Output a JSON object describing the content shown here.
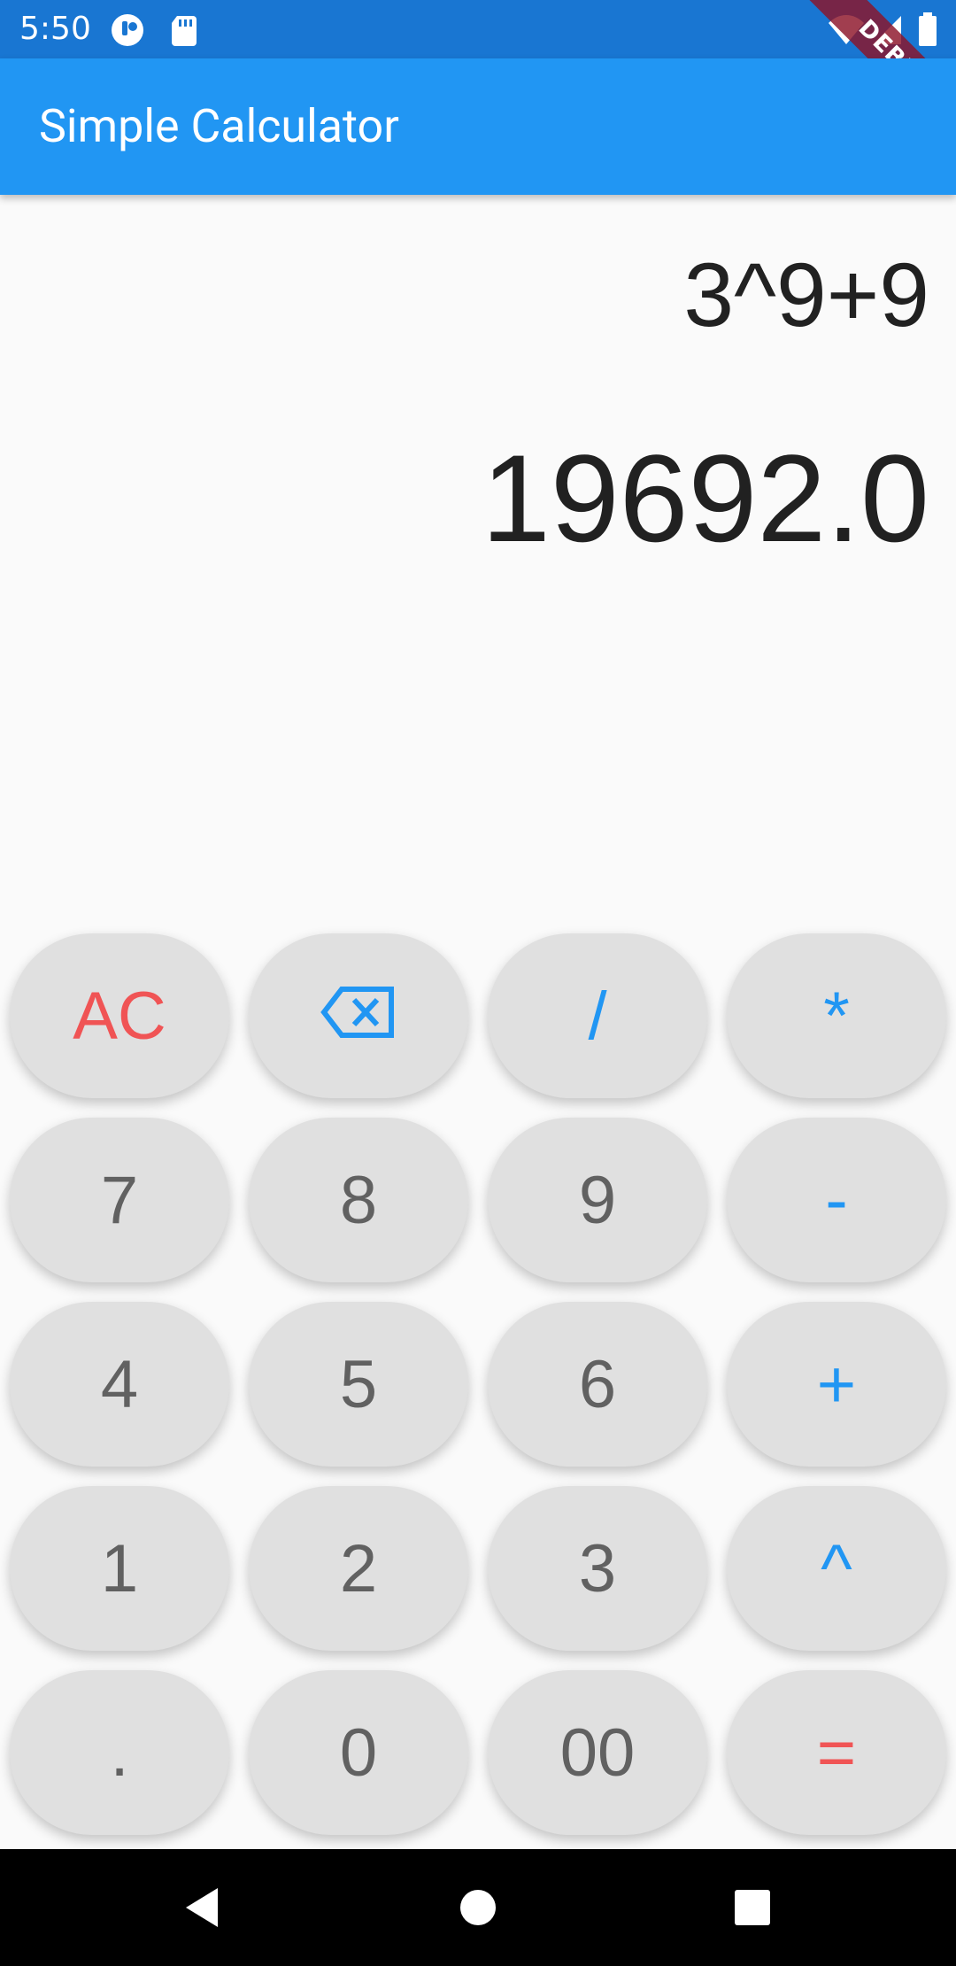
{
  "status_bar": {
    "time": "5:50",
    "left_icons": [
      "circle-app-icon",
      "sd-card-icon"
    ],
    "right_icons": [
      "wifi-icon",
      "signal-icon",
      "battery-icon"
    ],
    "debug_banner": "DEBUG"
  },
  "app_bar": {
    "title": "Simple Calculator"
  },
  "display": {
    "expression": "3^9+9",
    "result": "19692.0"
  },
  "keypad": {
    "rows": [
      [
        {
          "label": "AC",
          "kind": "danger"
        },
        {
          "label": "",
          "kind": "op",
          "icon": "backspace-icon"
        },
        {
          "label": "/",
          "kind": "op"
        },
        {
          "label": "*",
          "kind": "op"
        }
      ],
      [
        {
          "label": "7",
          "kind": "num"
        },
        {
          "label": "8",
          "kind": "num"
        },
        {
          "label": "9",
          "kind": "num"
        },
        {
          "label": "-",
          "kind": "op"
        }
      ],
      [
        {
          "label": "4",
          "kind": "num"
        },
        {
          "label": "5",
          "kind": "num"
        },
        {
          "label": "6",
          "kind": "num"
        },
        {
          "label": "+",
          "kind": "op"
        }
      ],
      [
        {
          "label": "1",
          "kind": "num"
        },
        {
          "label": "2",
          "kind": "num"
        },
        {
          "label": "3",
          "kind": "num"
        },
        {
          "label": "^",
          "kind": "op"
        }
      ],
      [
        {
          "label": ".",
          "kind": "num"
        },
        {
          "label": "0",
          "kind": "num"
        },
        {
          "label": "00",
          "kind": "num"
        },
        {
          "label": "=",
          "kind": "danger"
        }
      ]
    ]
  },
  "nav_bar": {
    "buttons": [
      "back-icon",
      "home-icon",
      "recents-icon"
    ]
  },
  "colors": {
    "status_bar": "#1976d2",
    "app_bar": "#2196f3",
    "operator": "#2196f3",
    "danger": "#f05455",
    "number": "#616161",
    "key_bg": "#e0e0e0",
    "background": "#fafafa"
  }
}
